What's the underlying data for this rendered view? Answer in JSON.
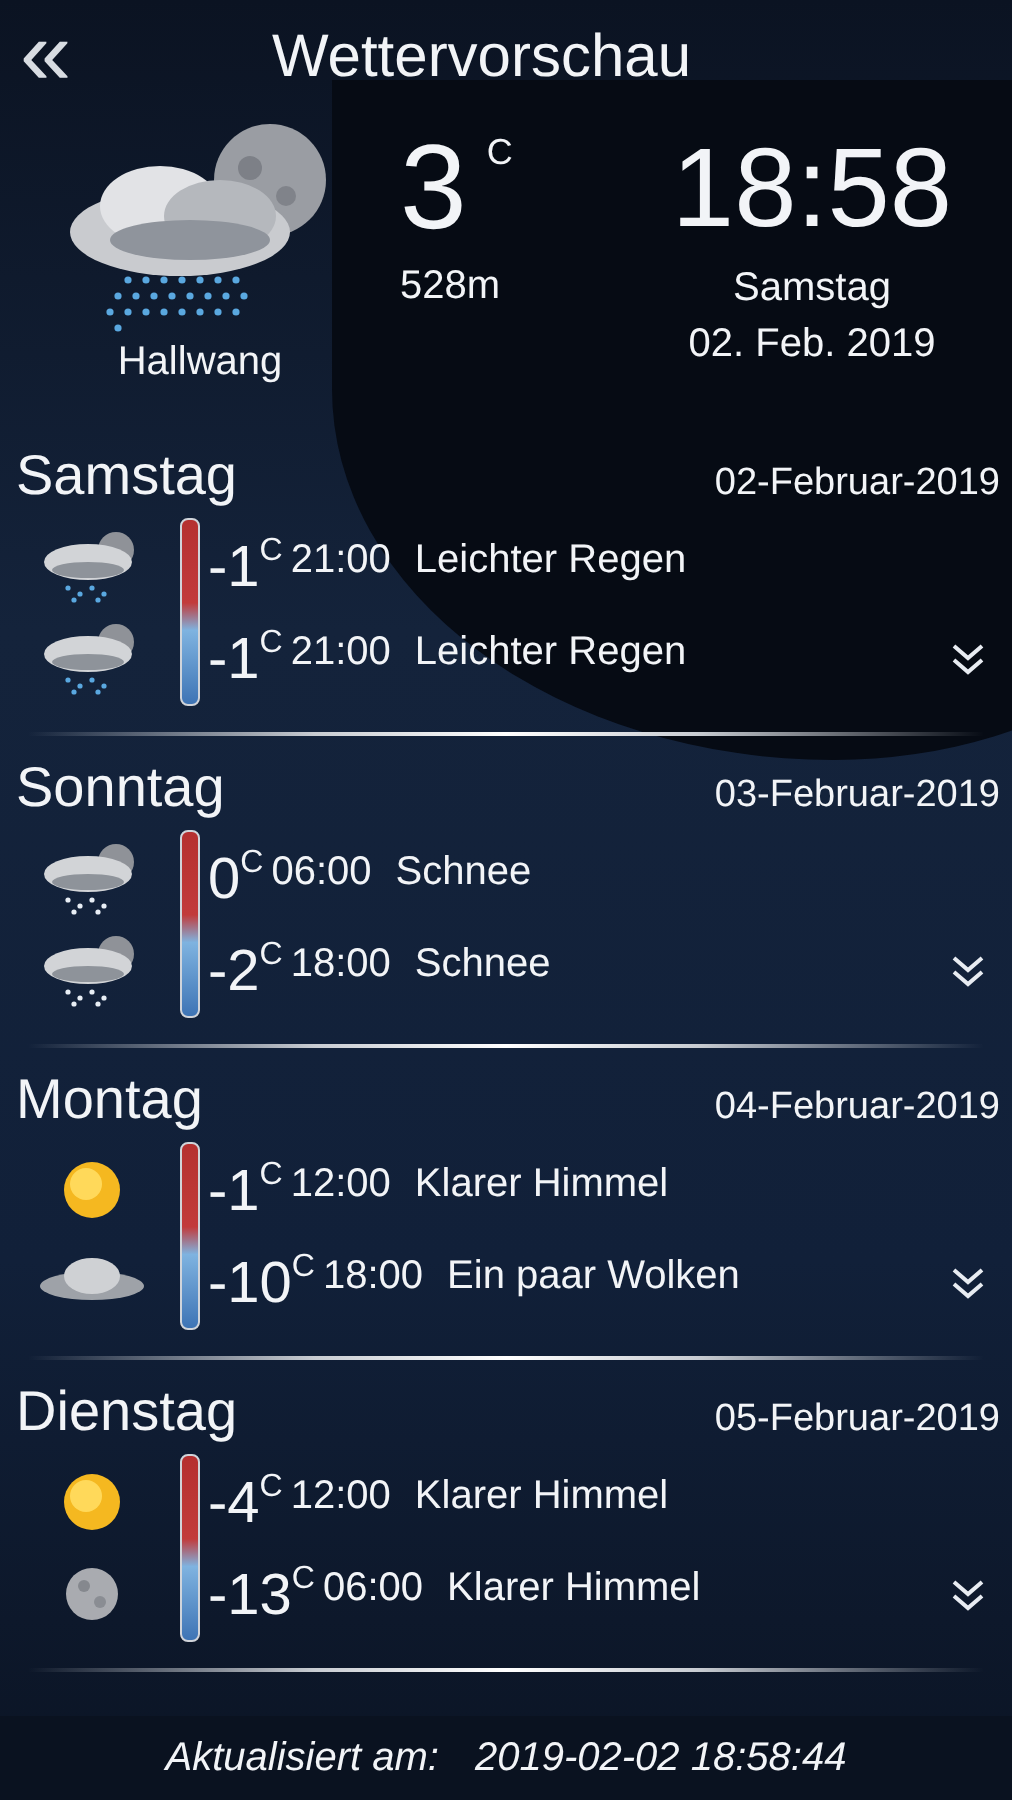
{
  "header": {
    "back": "«",
    "title": "Wettervorschau"
  },
  "current": {
    "kind": "rain-moon",
    "temp": "3",
    "unit": "C",
    "altitude": "528m",
    "place": "Hallwang",
    "time": "18:58",
    "weekday": "Samstag",
    "date": "02. Feb. 2019"
  },
  "days": [
    {
      "name": "Samstag",
      "date": "02-Februar-2019",
      "entries": [
        {
          "kind": "rain",
          "temp": "-1",
          "unit": "C",
          "time": "21:00",
          "text": "Leichter Regen"
        },
        {
          "kind": "rain",
          "temp": "-1",
          "unit": "C",
          "time": "21:00",
          "text": "Leichter Regen"
        }
      ]
    },
    {
      "name": "Sonntag",
      "date": "03-Februar-2019",
      "entries": [
        {
          "kind": "snow",
          "temp": "0",
          "unit": "C",
          "time": "06:00",
          "text": "Schnee"
        },
        {
          "kind": "snow",
          "temp": "-2",
          "unit": "C",
          "time": "18:00",
          "text": "Schnee"
        }
      ]
    },
    {
      "name": "Montag",
      "date": "04-Februar-2019",
      "entries": [
        {
          "kind": "sun",
          "temp": "-1",
          "unit": "C",
          "time": "12:00",
          "text": "Klarer Himmel"
        },
        {
          "kind": "cloud",
          "temp": "-10",
          "unit": "C",
          "time": "18:00",
          "text": "Ein paar Wolken"
        }
      ]
    },
    {
      "name": "Dienstag",
      "date": "05-Februar-2019",
      "entries": [
        {
          "kind": "sun",
          "temp": "-4",
          "unit": "C",
          "time": "12:00",
          "text": "Klarer Himmel"
        },
        {
          "kind": "moon",
          "temp": "-13",
          "unit": "C",
          "time": "06:00",
          "text": "Klarer Himmel"
        }
      ]
    }
  ],
  "footer": {
    "label": "Aktualisiert am:",
    "value": "2019-02-02 18:58:44"
  }
}
